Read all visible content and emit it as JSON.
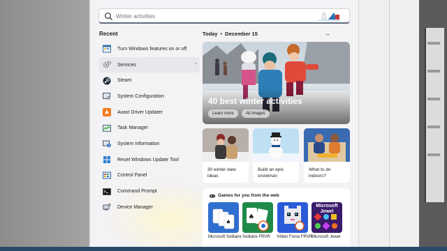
{
  "search": {
    "placeholder": "Winter activities",
    "icon": "search-icon"
  },
  "recent": {
    "heading": "Recent",
    "items": [
      {
        "label": "Turn Windows features on or off",
        "icon": "windows-features-icon"
      },
      {
        "label": "Services",
        "icon": "services-icon",
        "hover": true
      },
      {
        "label": "Steam",
        "icon": "steam-icon"
      },
      {
        "label": "System Configuration",
        "icon": "system-configuration-icon"
      },
      {
        "label": "Avast Driver Updater",
        "icon": "avast-driver-updater-icon"
      },
      {
        "label": "Task Manager",
        "icon": "task-manager-icon"
      },
      {
        "label": "System Information",
        "icon": "system-information-icon"
      },
      {
        "label": "Reset Windows Update Tool",
        "icon": "reset-windows-update-icon"
      },
      {
        "label": "Control Panel",
        "icon": "control-panel-icon"
      },
      {
        "label": "Command Prompt",
        "icon": "command-prompt-icon"
      },
      {
        "label": "Device Manager",
        "icon": "device-manager-icon"
      }
    ],
    "close_glyph": "×"
  },
  "today": {
    "label": "Today",
    "separator": "•",
    "date": "December 15",
    "more": "..."
  },
  "hero": {
    "title": "40 best winter activities",
    "learn_more": "Learn more",
    "all_images": "All images"
  },
  "cards": [
    {
      "label": "30 winter date ideas"
    },
    {
      "label": "Build an epic snowman"
    },
    {
      "label": "What to do indoors?"
    }
  ],
  "games": {
    "heading": "Games for you from the web",
    "items": [
      {
        "label": "Microsoft Solitaire"
      },
      {
        "label": "Solitaire FRVR"
      },
      {
        "label": "Kitten Force FRVR"
      },
      {
        "label": "Microsoft Jewel"
      }
    ],
    "jewel_tile_text": "Microsoft Jewel"
  },
  "colors": {
    "panel": "#f3f2f5",
    "hover": "#e8e8ec",
    "accent": "#0067c0"
  }
}
